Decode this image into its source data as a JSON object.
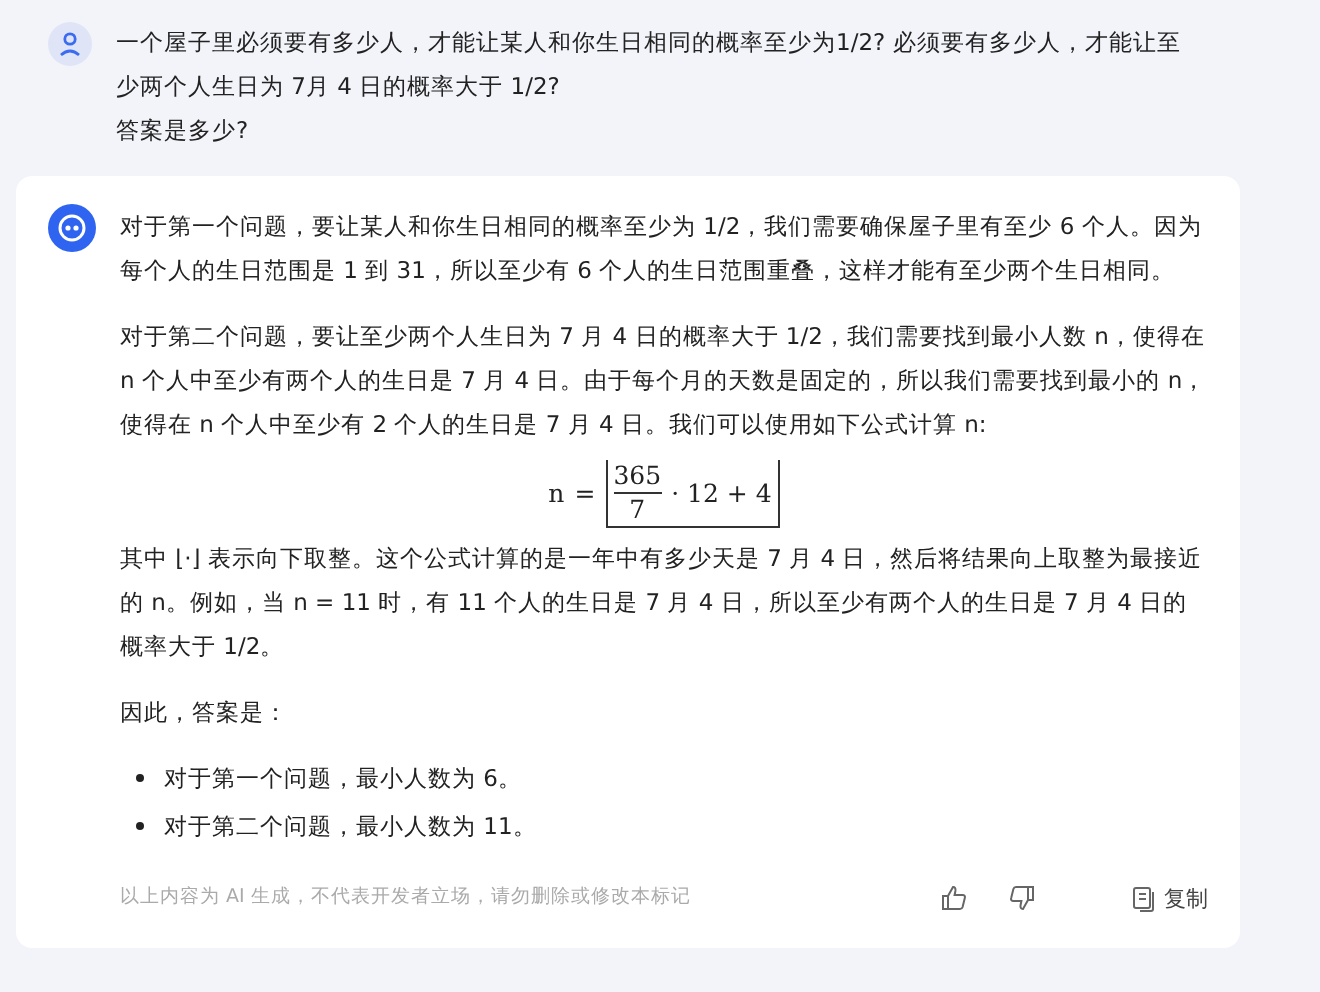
{
  "question": {
    "lines": [
      "一个屋子里必须要有多少人，才能让某人和你生日相同的概率至少为1/2? 必须要有多少人，才能让至少两个人生日为 7月 4 日的概率大于 1/2?",
      "答案是多少?"
    ]
  },
  "answer": {
    "paragraphs_before": [
      "对于第一个问题，要让某人和你生日相同的概率至少为 1/2，我们需要确保屋子里有至少 6 个人。因为每个人的生日范围是 1 到 31，所以至少有 6 个人的生日范围重叠，这样才能有至少两个生日相同。",
      "对于第二个问题，要让至少两个人生日为 7 月 4 日的概率大于 1/2，我们需要找到最小人数 n，使得在 n 个人中至少有两个人的生日是 7 月 4 日。由于每个月的天数是固定的，所以我们需要找到最小的 n，使得在 n 个人中至少有 2 个人的生日是 7 月 4 日。我们可以使用如下公式计算 n:"
    ],
    "formula": {
      "lhs": "n",
      "eq": "=",
      "numerator": "365",
      "denominator": "7",
      "rest": "· 12 + 4"
    },
    "paragraphs_after": [
      "其中 ⌊·⌋ 表示向下取整。这个公式计算的是一年中有多少天是 7 月 4 日，然后将结果向上取整为最接近的 n。例如，当 n = 11 时，有 11 个人的生日是 7 月 4 日，所以至少有两个人的生日是 7 月 4 日的概率大于 1/2。",
      "因此，答案是："
    ],
    "bullets": [
      "对于第一个问题，最小人数为 6。",
      "对于第二个问题，最小人数为 11。"
    ],
    "disclaimer": "以上内容为 AI 生成，不代表开发者立场，请勿删除或修改本标记",
    "copy_label": "复制"
  }
}
